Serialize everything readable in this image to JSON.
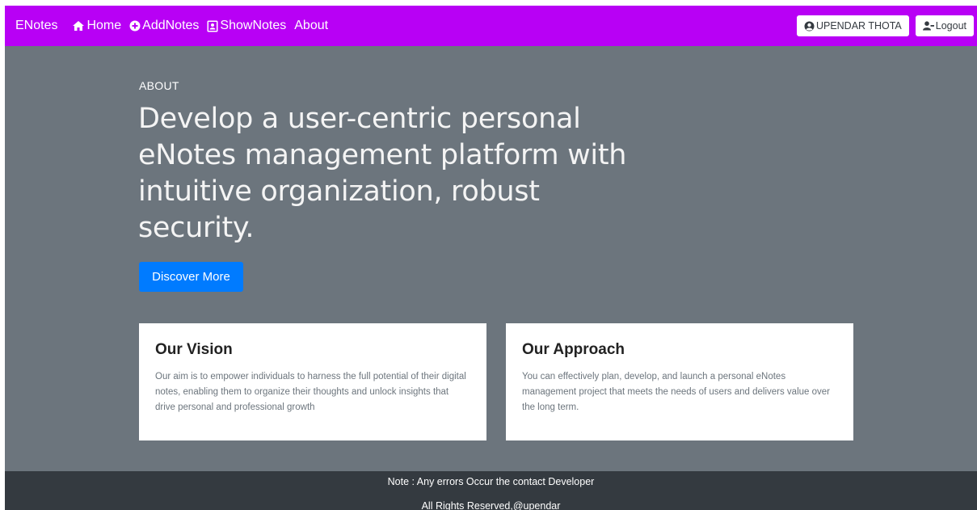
{
  "navbar": {
    "brand": "ENotes",
    "links": [
      {
        "label": "Home",
        "icon": "home-icon"
      },
      {
        "label": "AddNotes",
        "icon": "plus-circle-icon"
      },
      {
        "label": "ShowNotes",
        "icon": "address-book-icon"
      },
      {
        "label": "About"
      }
    ],
    "user_button": {
      "label": "UPENDAR THOTA",
      "icon": "user-circle-icon"
    },
    "logout_button": {
      "label": "Logout",
      "icon": "user-minus-icon"
    },
    "bg_color": "#b800f5"
  },
  "hero": {
    "label": "ABOUT",
    "title": "Develop a user-centric personal eNotes management platform with intuitive organization, robust security.",
    "button_label": "Discover More",
    "button_color": "#007bff"
  },
  "cards": [
    {
      "title": "Our Vision",
      "text": "Our aim is to empower individuals to harness the full potential of their digital notes, enabling them to organize their thoughts and unlock insights that drive personal and professional growth"
    },
    {
      "title": "Our Approach",
      "text": "You can effectively plan, develop, and launch a personal eNotes management project that meets the needs of users and delivers value over the long term."
    }
  ],
  "footer": {
    "note": "Note : Any errors Occur the contact Developer",
    "rights": "All Rights Reserved,@upendar"
  }
}
